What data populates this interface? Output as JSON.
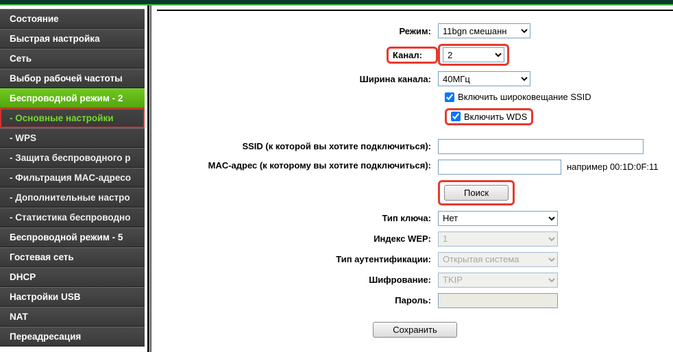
{
  "sidebar": {
    "items": [
      {
        "label": "Состояние"
      },
      {
        "label": "Быстрая настройка"
      },
      {
        "label": "Сеть"
      },
      {
        "label": "Выбор рабочей частоты"
      },
      {
        "label": "Беспроводной режим - 2"
      },
      {
        "label": "- Основные настройки"
      },
      {
        "label": "- WPS"
      },
      {
        "label": "- Защита беспроводного р"
      },
      {
        "label": "- Фильтрация MAC-адресо"
      },
      {
        "label": "- Дополнительные настро"
      },
      {
        "label": "- Статистика беспроводно"
      },
      {
        "label": "Беспроводной режим - 5"
      },
      {
        "label": "Гостевая сеть"
      },
      {
        "label": "DHCP"
      },
      {
        "label": "Настройки USB"
      },
      {
        "label": "NAT"
      },
      {
        "label": "Переадресация"
      }
    ]
  },
  "form": {
    "mode_label": "Режим:",
    "mode_value": "11bgn смешанн",
    "channel_label": "Канал:",
    "channel_value": "2",
    "width_label": "Ширина канала:",
    "width_value": "40МГц",
    "ssid_broadcast_label": "Включить широковещание SSID",
    "wds_label": "Включить WDS",
    "ssid_label": "SSID (к которой вы хотите подключиться):",
    "ssid_value": "",
    "mac_label": "MAC-адрес (к которому вы хотите подключиться):",
    "mac_value": "",
    "mac_hint": "например 00:1D:0F:11",
    "search_btn": "Поиск",
    "keytype_label": "Тип ключа:",
    "keytype_value": "Нет",
    "wepidx_label": "Индекс WEP:",
    "wepidx_value": "1",
    "auth_label": "Тип аутентификации:",
    "auth_value": "Открытая система",
    "enc_label": "Шифрование:",
    "enc_value": "TKIP",
    "pwd_label": "Пароль:",
    "pwd_value": "",
    "save_btn": "Сохранить"
  }
}
